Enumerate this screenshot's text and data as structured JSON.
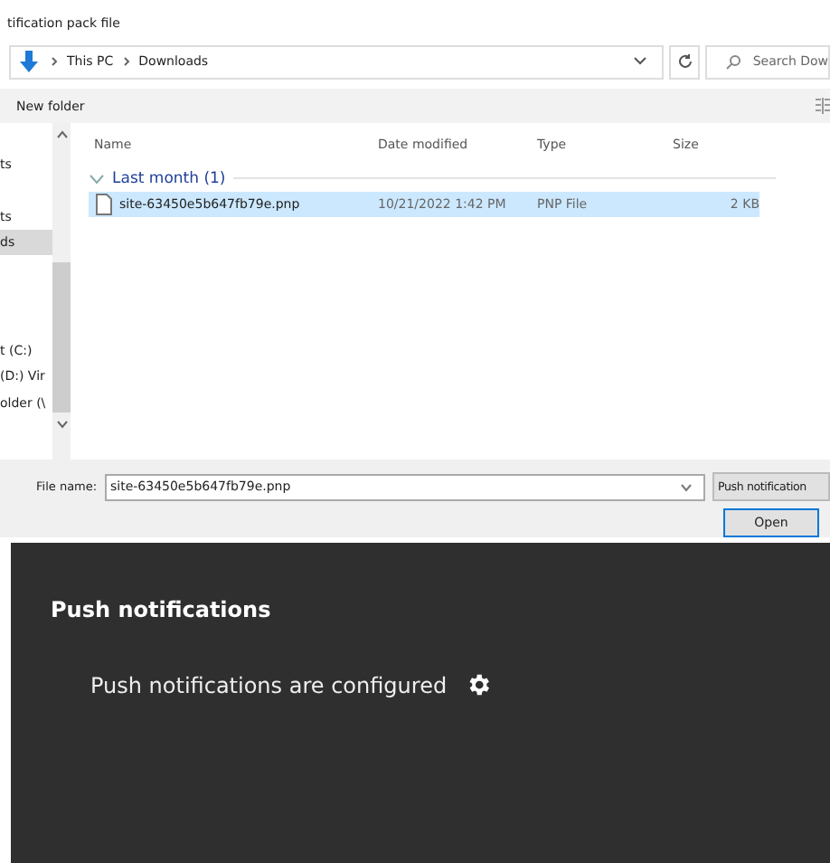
{
  "dialog": {
    "title": "tification pack file",
    "address": {
      "path": [
        "This PC",
        "Downloads"
      ],
      "search_placeholder": "Search Dow"
    },
    "toolbar": {
      "new_folder": "New folder"
    },
    "nav_items": [
      {
        "label": "ts",
        "selected": false
      },
      {
        "label": "ts",
        "selected": false
      },
      {
        "label": "ds",
        "selected": true
      },
      {
        "label": "t (C:)",
        "selected": false
      },
      {
        "label": "(D:) Vir",
        "selected": false
      },
      {
        "label": "older (\\",
        "selected": false
      }
    ],
    "columns": [
      "Name",
      "Date modified",
      "Type",
      "Size"
    ],
    "groups": [
      {
        "label": "Last month (1)",
        "expanded": true,
        "files": [
          {
            "name": "site-63450e5b647fb79e.pnp",
            "date": "10/21/2022 1:42 PM",
            "type": "PNP File",
            "size": "2 KB",
            "selected": true
          }
        ]
      }
    ],
    "file_name": {
      "label": "File name:",
      "value": "site-63450e5b647fb79e.pnp"
    },
    "file_type": "Push notification",
    "buttons": [
      {
        "label": "Open",
        "default": true
      }
    ]
  },
  "panel": {
    "heading": "Push notifications",
    "status": "Push notifications are configured"
  }
}
